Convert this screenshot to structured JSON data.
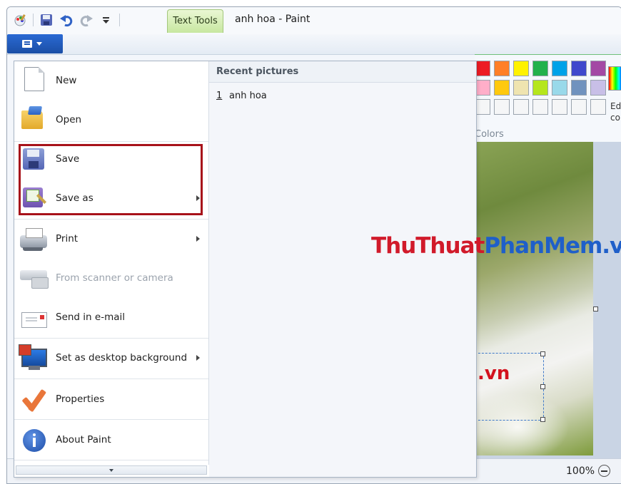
{
  "window": {
    "title": "anh hoa - Paint",
    "context_tab": "Text Tools"
  },
  "qat": {
    "icons": [
      "paint-app-icon",
      "save-icon",
      "undo-icon",
      "redo-icon",
      "customize-dropdown-icon"
    ]
  },
  "file_menu": {
    "items": [
      {
        "label": "New",
        "icon": "new-document-icon",
        "submenu": false,
        "enabled": true
      },
      {
        "label": "Open",
        "icon": "open-folder-icon",
        "submenu": false,
        "enabled": true
      },
      {
        "label": "Save",
        "icon": "save-disk-icon",
        "submenu": false,
        "enabled": true
      },
      {
        "label": "Save as",
        "icon": "save-as-icon",
        "submenu": true,
        "enabled": true
      },
      {
        "label": "Print",
        "icon": "printer-icon",
        "submenu": true,
        "enabled": true
      },
      {
        "label": "From scanner or camera",
        "icon": "scanner-icon",
        "submenu": false,
        "enabled": false
      },
      {
        "label": "Send in e-mail",
        "icon": "email-icon",
        "submenu": false,
        "enabled": true
      },
      {
        "label": "Set as desktop background",
        "icon": "desktop-icon",
        "submenu": true,
        "enabled": true
      },
      {
        "label": "Properties",
        "icon": "checkmark-icon",
        "submenu": false,
        "enabled": true
      },
      {
        "label": "About Paint",
        "icon": "info-icon",
        "submenu": false,
        "enabled": true
      }
    ],
    "recent": {
      "header": "Recent pictures",
      "items": [
        {
          "num": "1",
          "name": "anh hoa"
        }
      ]
    }
  },
  "ribbon": {
    "group_label": "Colors",
    "edit_colors_label": "Ed col",
    "swatches": [
      [
        "#ed1c24",
        "#ff7f27",
        "#fff200",
        "#22b14c",
        "#00a2e8",
        "#3f48cc",
        "#a349a4"
      ],
      [
        "#ffaec9",
        "#ffc90e",
        "#efe4b0",
        "#b5e61d",
        "#99d9ea",
        "#7092be",
        "#c8bfe7"
      ],
      [
        "#f5f6f7",
        "#f5f6f7",
        "#f5f6f7",
        "#f5f6f7",
        "#f5f6f7",
        "#f5f6f7",
        "#f5f6f7"
      ]
    ]
  },
  "canvas": {
    "image_text": ".vn",
    "watermark_part1": "ThuThuat",
    "watermark_part2": "PhanMem.vn"
  },
  "status": {
    "zoom": "100%"
  }
}
